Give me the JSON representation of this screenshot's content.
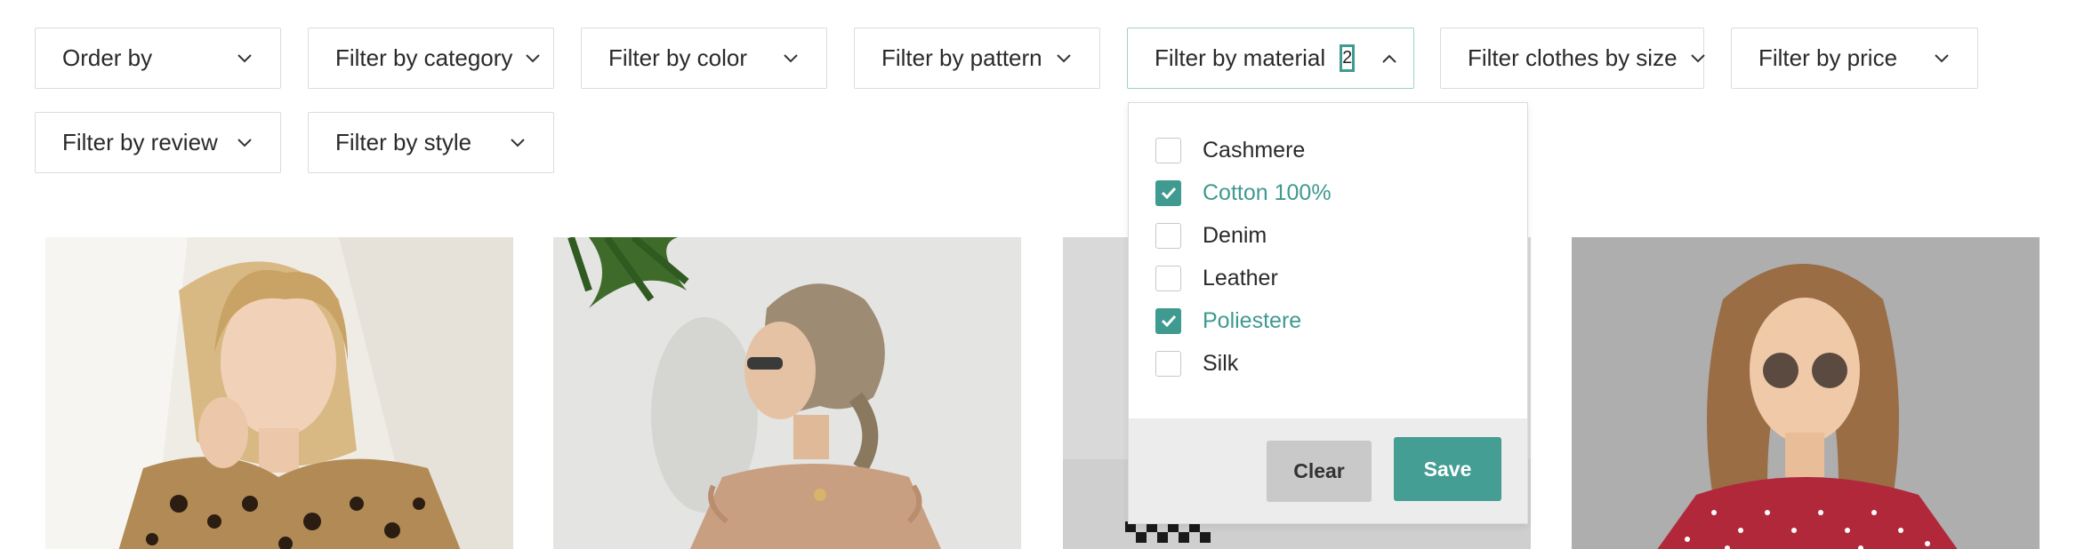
{
  "filters": {
    "order": "Order by",
    "category": "Filter by category",
    "color": "Filter by color",
    "pattern": "Filter by pattern",
    "material": "Filter by material",
    "material_count": "2",
    "size": "Filter clothes by size",
    "price": "Filter by price",
    "review": "Filter by review",
    "style": "Filter by style"
  },
  "material_dropdown": {
    "options": [
      {
        "label": "Cashmere",
        "checked": false
      },
      {
        "label": "Cotton 100%",
        "checked": true
      },
      {
        "label": "Denim",
        "checked": false
      },
      {
        "label": "Leather",
        "checked": false
      },
      {
        "label": "Poliestere",
        "checked": true
      },
      {
        "label": "Silk",
        "checked": false
      }
    ],
    "clear_label": "Clear",
    "save_label": "Save"
  },
  "theme": {
    "accent": "#449e94",
    "border": "#dcdcdc"
  }
}
